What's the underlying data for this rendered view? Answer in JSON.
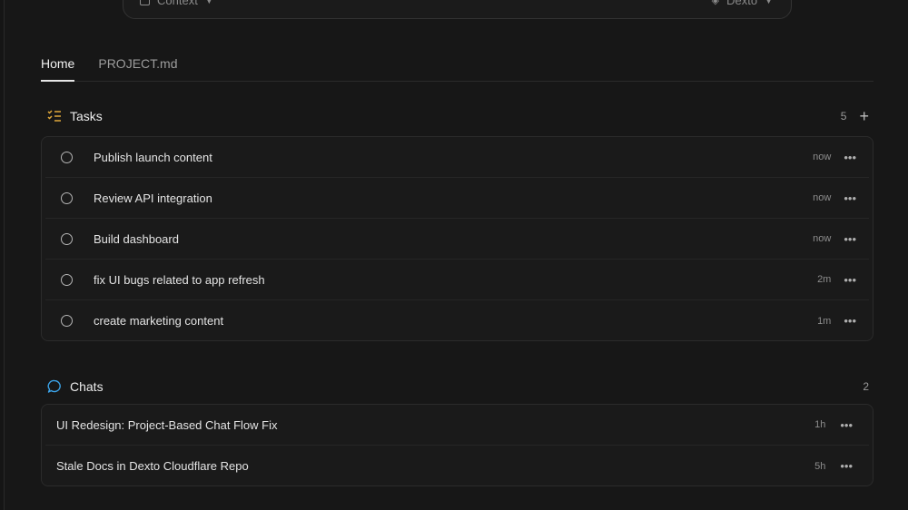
{
  "composer": {
    "context_label": "Context",
    "model_label": "Dexto"
  },
  "tabs": [
    {
      "label": "Home"
    },
    {
      "label": "PROJECT.md"
    }
  ],
  "tasks": {
    "title": "Tasks",
    "count": "5",
    "icon": "task-list-icon",
    "accent": "#e0a93b",
    "items": [
      {
        "title": "Publish launch content",
        "time": "now"
      },
      {
        "title": "Review API integration",
        "time": "now"
      },
      {
        "title": "Build dashboard",
        "time": "now"
      },
      {
        "title": "fix UI bugs related to app refresh",
        "time": "2m"
      },
      {
        "title": "create marketing content",
        "time": "1m"
      }
    ]
  },
  "chats": {
    "title": "Chats",
    "count": "2",
    "icon": "chat-bubble-icon",
    "accent": "#3ba3e8",
    "items": [
      {
        "title": "UI Redesign: Project-Based Chat Flow Fix",
        "time": "1h"
      },
      {
        "title": "Stale Docs in Dexto Cloudflare Repo",
        "time": "5h"
      }
    ]
  }
}
